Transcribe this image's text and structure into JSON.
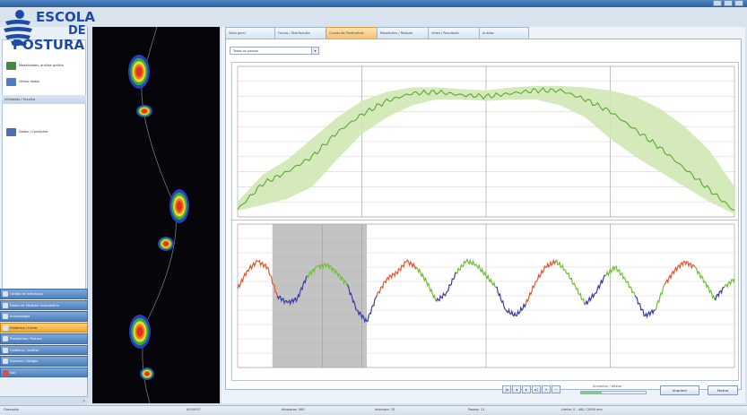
{
  "logo": {
    "line1": "ESCOLA",
    "line2": "DE",
    "line3": "POSTURA"
  },
  "sidebar": {
    "items_top": [
      {
        "label": "Modalidades, análise gráfica",
        "color": "#3f8f3a"
      },
      {
        "label": "Ultimo dados",
        "color": "#4c7ec8"
      }
    ],
    "section_label": "Utilidades / Escolha",
    "items_bottom": [
      {
        "label": "Dados / Condições",
        "color": "#4a6fb8"
      }
    ],
    "nav": [
      {
        "label": "Gestão de Indivíduos",
        "active": false
      },
      {
        "label": "Dados de Medição Ambulatório",
        "active": false
      },
      {
        "label": "Antropologia",
        "active": false
      },
      {
        "label": "Dinâmica / Correr",
        "active": true
      },
      {
        "label": "Plataforma / Postura",
        "active": false
      },
      {
        "label": "Cadência / Análise",
        "active": false
      },
      {
        "label": "Exportar / Estágio",
        "active": false
      },
      {
        "label": "Sair",
        "active": false
      }
    ],
    "foot": "»"
  },
  "tabs": [
    "Vista geral",
    "Forças / Distribuição",
    "Curvas de Parâmetros",
    "Repetições / Relação",
    "Vídeo / Resultado",
    "Análise"
  ],
  "active_tab": 2,
  "dropdown": {
    "value": "Todos os passos",
    "arrow": "▾"
  },
  "pager": [
    "|◂",
    "◂",
    "▸",
    "▸|",
    "+",
    "−"
  ],
  "zoom": {
    "label": "Aumentar / Alterar",
    "fill": 0.32
  },
  "buttons": {
    "print": "Imprimir",
    "close": "Fechar"
  },
  "status": {
    "s1": "Gravação",
    "s2": "00:00:07",
    "s3": "Amostras: 300",
    "s4": "Intervalo: 70",
    "s5": "Passos: 11",
    "s6": "Limite: 0 - 400 / 2000 mm"
  },
  "colors": {
    "mean_line": "#5aa832",
    "band": "#cfe8b4",
    "cop_red": "#e7542a",
    "cop_green": "#6fbf36",
    "cop_blue": "#3a3aa8",
    "selection": "#b7b7b7"
  },
  "chart_data": [
    {
      "type": "line",
      "title": "",
      "xlabel": "",
      "ylabel": "",
      "xlim": [
        0,
        100
      ],
      "ylim": [
        0,
        100
      ],
      "grid": true,
      "x": [
        0,
        5,
        10,
        15,
        20,
        25,
        30,
        35,
        40,
        45,
        50,
        55,
        60,
        65,
        70,
        75,
        80,
        85,
        90,
        95,
        100
      ],
      "series": [
        {
          "values": [
            5,
            22,
            30,
            40,
            56,
            68,
            77,
            82,
            83,
            81,
            80,
            82,
            84,
            84,
            78,
            70,
            58,
            46,
            32,
            18,
            4
          ]
        }
      ],
      "band": {
        "lower": [
          4,
          8,
          12,
          20,
          38,
          55,
          66,
          74,
          78,
          78,
          77,
          78,
          78,
          74,
          66,
          52,
          40,
          30,
          20,
          10,
          2
        ],
        "upper": [
          10,
          28,
          38,
          52,
          66,
          77,
          83,
          86,
          86,
          85,
          84,
          86,
          87,
          87,
          86,
          84,
          80,
          72,
          60,
          44,
          20
        ]
      }
    },
    {
      "type": "line",
      "title": "",
      "xlabel": "",
      "ylabel": "",
      "xlim": [
        0,
        100
      ],
      "ylim": [
        0,
        100
      ],
      "grid": true,
      "highlight_x": [
        7,
        26
      ],
      "x": [
        0,
        2,
        4,
        6,
        8,
        10,
        12,
        14,
        16,
        18,
        20,
        22,
        24,
        26,
        28,
        30,
        32,
        34,
        36,
        38,
        40,
        42,
        44,
        46,
        48,
        50,
        52,
        54,
        56,
        58,
        60,
        62,
        64,
        66,
        68,
        70,
        72,
        74,
        76,
        78,
        80,
        82,
        84,
        86,
        88,
        90,
        92,
        94,
        96,
        98,
        100
      ],
      "series": [
        {
          "values": [
            55,
            68,
            74,
            70,
            50,
            45,
            48,
            64,
            70,
            72,
            66,
            58,
            40,
            32,
            50,
            62,
            66,
            74,
            70,
            60,
            46,
            52,
            66,
            74,
            72,
            64,
            56,
            40,
            36,
            44,
            60,
            70,
            74,
            68,
            56,
            44,
            52,
            64,
            70,
            62,
            50,
            36,
            40,
            58,
            68,
            74,
            70,
            60,
            48,
            56,
            62
          ],
          "colors": [
            "r",
            "r",
            "r",
            "r",
            "b",
            "b",
            "b",
            "g",
            "g",
            "g",
            "g",
            "b",
            "b",
            "b",
            "r",
            "r",
            "r",
            "r",
            "g",
            "g",
            "b",
            "b",
            "g",
            "g",
            "g",
            "g",
            "b",
            "b",
            "b",
            "r",
            "r",
            "r",
            "g",
            "g",
            "g",
            "b",
            "b",
            "g",
            "g",
            "g",
            "b",
            "b",
            "g",
            "r",
            "r",
            "r",
            "g",
            "g",
            "b",
            "g",
            "g"
          ]
        }
      ]
    }
  ],
  "heatmap": {
    "blobs": [
      {
        "x": 52,
        "y": 50,
        "rx": 12,
        "ry": 19
      },
      {
        "x": 58,
        "y": 94,
        "rx": 9,
        "ry": 7
      },
      {
        "x": 97,
        "y": 200,
        "rx": 11,
        "ry": 19
      },
      {
        "x": 82,
        "y": 242,
        "rx": 9,
        "ry": 8
      },
      {
        "x": 53,
        "y": 340,
        "rx": 12,
        "ry": 19
      },
      {
        "x": 61,
        "y": 387,
        "rx": 8,
        "ry": 7
      }
    ],
    "colors": [
      "#2a3cc0",
      "#2fae3d",
      "#e8d63a",
      "#f07a1c",
      "#e3321c"
    ]
  }
}
